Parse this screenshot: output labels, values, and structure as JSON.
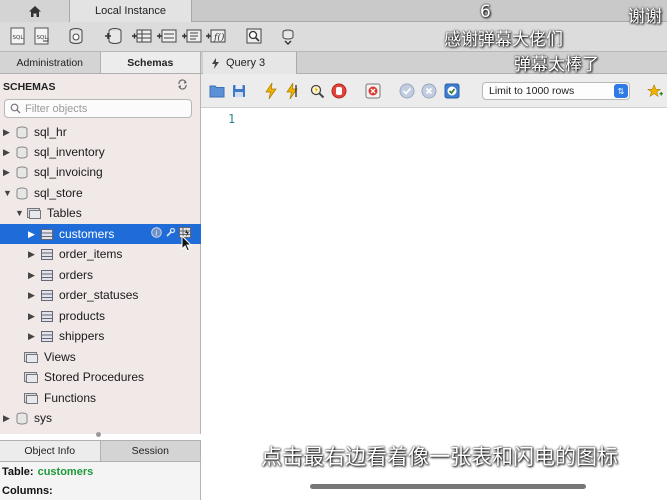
{
  "top_tabs": {
    "home_icon": "home-icon",
    "instance_label": "Local Instance"
  },
  "panel_tabs": {
    "administration": "Administration",
    "schemas": "Schemas"
  },
  "editor_tabs": {
    "query_label": "Query 3"
  },
  "sidebar": {
    "header": "SCHEMAS",
    "filter_placeholder": "Filter objects",
    "tree": [
      {
        "label": "sql_hr",
        "kind": "schema",
        "expanded": false
      },
      {
        "label": "sql_inventory",
        "kind": "schema",
        "expanded": false
      },
      {
        "label": "sql_invoicing",
        "kind": "schema",
        "expanded": false
      },
      {
        "label": "sql_store",
        "kind": "schema",
        "expanded": true
      },
      {
        "label": "Tables",
        "kind": "folder",
        "expanded": true
      },
      {
        "label": "customers",
        "kind": "table",
        "selected": true
      },
      {
        "label": "order_items",
        "kind": "table"
      },
      {
        "label": "orders",
        "kind": "table"
      },
      {
        "label": "order_statuses",
        "kind": "table"
      },
      {
        "label": "products",
        "kind": "table"
      },
      {
        "label": "shippers",
        "kind": "table"
      },
      {
        "label": "Views",
        "kind": "folder"
      },
      {
        "label": "Stored Procedures",
        "kind": "folder"
      },
      {
        "label": "Functions",
        "kind": "folder"
      },
      {
        "label": "sys",
        "kind": "schema",
        "expanded": false
      }
    ]
  },
  "info_panel": {
    "tabs": [
      "Object Info",
      "Session"
    ],
    "table_label": "Table:",
    "table_value": "customers",
    "columns_label": "Columns:"
  },
  "editor": {
    "limit_label": "Limit to 1000 rows",
    "line_numbers": [
      "1"
    ]
  },
  "overlay": {
    "danmaku_number": "6",
    "danmaku_thanks": "谢谢",
    "danmaku_1": "感谢弹幕大佬们",
    "danmaku_2": "弹幕太棒了",
    "subtitle": "点击最右边看着像一张表和闪电的图标"
  },
  "colors": {
    "selection": "#1f6cd8",
    "sidebar_bg": "#f1e8e8",
    "line_number": "#2a8a8a",
    "accent_green": "#1e9a3a"
  }
}
